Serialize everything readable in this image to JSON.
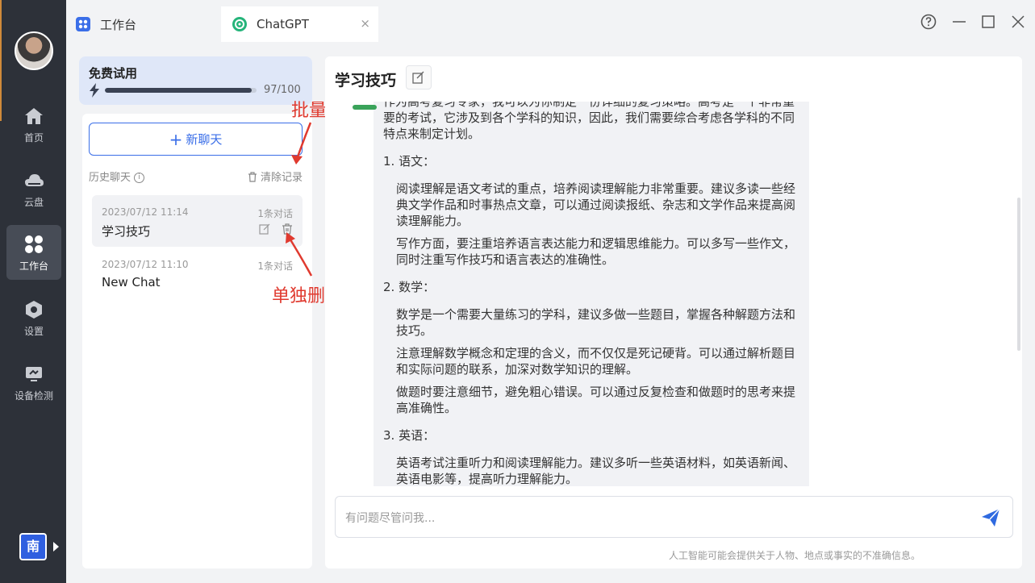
{
  "nav": {
    "items": [
      {
        "label": "首页",
        "icon": "home-icon"
      },
      {
        "label": "云盘",
        "icon": "cloud-icon"
      },
      {
        "label": "工作台",
        "icon": "grid-icon"
      },
      {
        "label": "设置",
        "icon": "hexagon-icon"
      },
      {
        "label": "设备检测",
        "icon": "monitor-icon"
      }
    ],
    "lang": "南"
  },
  "tabs": [
    {
      "label": "工作台"
    },
    {
      "label": "ChatGPT",
      "close": "×"
    }
  ],
  "trial": {
    "title": "免费试用",
    "used": 97,
    "total": 100,
    "count_text": "97/100"
  },
  "sidebar": {
    "new_chat": "新聊天",
    "history_label": "历史聊天",
    "clear_label": "清除记录",
    "chats": [
      {
        "date": "2023/07/12 11:14",
        "count": "1条对话",
        "title": "学习技巧"
      },
      {
        "date": "2023/07/12 11:10",
        "count": "1条对话",
        "title": "New Chat"
      }
    ]
  },
  "annotations": {
    "batch_clear": "批量清除",
    "single_delete": "单独删除"
  },
  "main": {
    "title": "学习技巧",
    "content": {
      "intro": "作为高考复习专家，我可以为你制定一份详细的复习策略。高考是一个非常重要的考试，它涉及到各个学科的知识，因此，我们需要综合考虑各学科的不同特点来制定计划。",
      "sections": [
        {
          "heading": "1. 语文：",
          "points": [
            "阅读理解是语文考试的重点，培养阅读理解能力非常重要。建议多读一些经典文学作品和时事热点文章，可以通过阅读报纸、杂志和文学作品来提高阅读理解能力。",
            "写作方面，要注重培养语言表达能力和逻辑思维能力。可以多写一些作文，同时注重写作技巧和语言表达的准确性。"
          ]
        },
        {
          "heading": "2. 数学：",
          "points": [
            "数学是一个需要大量练习的学科，建议多做一些题目，掌握各种解题方法和技巧。",
            "注意理解数学概念和定理的含义，而不仅仅是死记硬背。可以通过解析题目和实际问题的联系，加深对数学知识的理解。",
            "做题时要注意细节，避免粗心错误。可以通过反复检查和做题时的思考来提高准确性。"
          ]
        },
        {
          "heading": "3. 英语：",
          "points": [
            "英语考试注重听力和阅读理解能力。建议多听一些英语材料，如英语新闻、英语电影等，提高听力理解能力。"
          ]
        }
      ]
    },
    "input_placeholder": "有问题尽管问我...",
    "disclaimer": "人工智能可能会提供关于人物、地点或事实的不准确信息。"
  },
  "colors": {
    "accent": "#3a6ee8",
    "annotation": "#e03a2f",
    "nav_bg": "#2d3139"
  }
}
